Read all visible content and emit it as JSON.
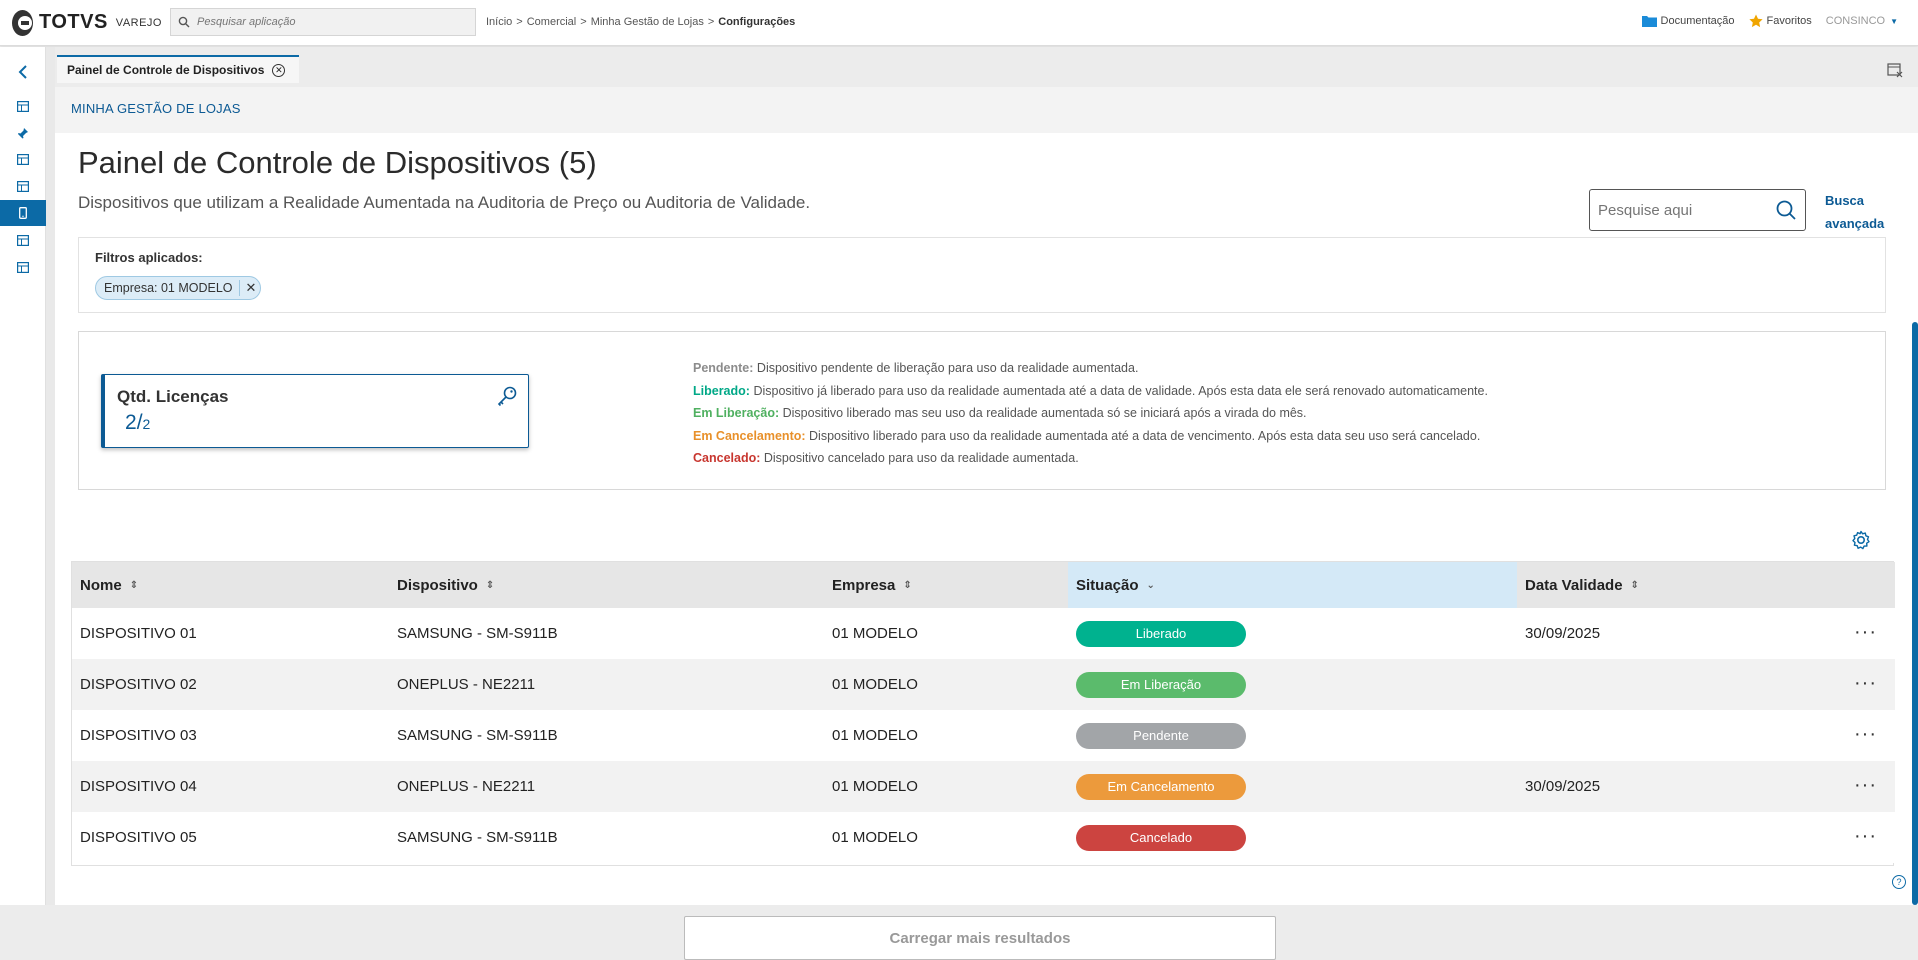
{
  "brand": {
    "name": "TOTVS",
    "sub": "VAREJO"
  },
  "search_app": {
    "placeholder": "Pesquisar aplicação"
  },
  "breadcrumb": {
    "items": [
      "Início",
      "Comercial",
      "Minha Gestão de Lojas"
    ],
    "current": "Configurações",
    "separator": ">"
  },
  "top_right": {
    "docs": "Documentação",
    "favorites": "Favoritos",
    "user": "CONSINCO"
  },
  "tab": {
    "label": "Painel de Controle de Dispositivos"
  },
  "module": {
    "title": "MINHA GESTÃO DE LOJAS"
  },
  "page": {
    "title": "Painel de Controle de Dispositivos (5)",
    "subtitle": "Dispositivos que utilizam a Realidade Aumentada na Auditoria de Preço ou Auditoria de Validade.",
    "search_placeholder": "Pesquise aqui",
    "busca_line1": "Busca",
    "busca_line2": "avançada"
  },
  "filters": {
    "label": "Filtros aplicados:",
    "chip": "Empresa: 01 MODELO"
  },
  "licenses": {
    "title": "Qtd. Licenças",
    "used": "2",
    "total": "2"
  },
  "legend": [
    {
      "key": "Pendente:",
      "text": "Dispositivo pendente de liberação para uso da realidade aumentada.",
      "color": "#8c8c8c"
    },
    {
      "key": "Liberado:",
      "text": "Dispositivo já liberado para uso da realidade aumentada até a data de validade. Após esta data ele será renovado automaticamente.",
      "color": "#00a887"
    },
    {
      "key": "Em Liberação:",
      "text": "Dispositivo liberado mas seu uso da realidade aumentada só se iniciará após a virada do mês.",
      "color": "#4fb060"
    },
    {
      "key": "Em Cancelamento:",
      "text": "Dispositivo liberado para uso da realidade aumentada até a data de vencimento. Após esta data seu uso será cancelado.",
      "color": "#e8902a"
    },
    {
      "key": "Cancelado:",
      "text": "Dispositivo cancelado para uso da realidade aumentada.",
      "color": "#c8362f"
    }
  ],
  "table": {
    "headers": [
      "Nome",
      "Dispositivo",
      "Empresa",
      "Situação",
      "Data Validade"
    ],
    "rows": [
      {
        "nome": "DISPOSITIVO 01",
        "dispositivo": "SAMSUNG - SM-S911B",
        "empresa": "01 MODELO",
        "situacao": "Liberado",
        "color": "#00b28f",
        "validade": "30/09/2025"
      },
      {
        "nome": "DISPOSITIVO 02",
        "dispositivo": "ONEPLUS - NE2211",
        "empresa": "01 MODELO",
        "situacao": "Em Liberação",
        "color": "#5bbb6c",
        "validade": ""
      },
      {
        "nome": "DISPOSITIVO 03",
        "dispositivo": "SAMSUNG - SM-S911B",
        "empresa": "01 MODELO",
        "situacao": "Pendente",
        "color": "#a2a5a8",
        "validade": ""
      },
      {
        "nome": "DISPOSITIVO 04",
        "dispositivo": "ONEPLUS - NE2211",
        "empresa": "01 MODELO",
        "situacao": "Em Cancelamento",
        "color": "#ec9a3c",
        "validade": "30/09/2025"
      },
      {
        "nome": "DISPOSITIVO 05",
        "dispositivo": "SAMSUNG - SM-S911B",
        "empresa": "01 MODELO",
        "situacao": "Cancelado",
        "color": "#cc4440",
        "validade": ""
      }
    ]
  },
  "load_more": "Carregar mais resultados",
  "colors": {
    "accent": "#0c6aa6",
    "brand_blue": "#0c5a94"
  }
}
